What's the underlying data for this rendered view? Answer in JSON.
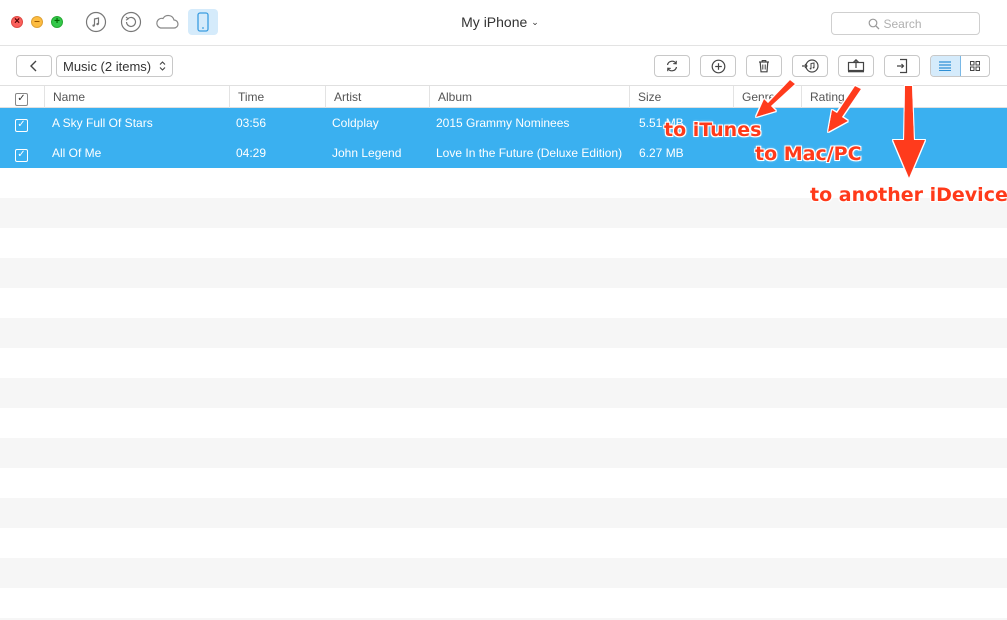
{
  "titlebar": {
    "device_name": "My iPhone",
    "search_placeholder": "Search",
    "modes": [
      "music-icon",
      "backup-icon",
      "cloud-icon",
      "iphone-icon"
    ]
  },
  "toolbar": {
    "back_icon": "chevron-left-icon",
    "folder_label": "Music (2 items)",
    "actions": [
      "refresh-icon",
      "add-icon",
      "delete-icon",
      "to-itunes-icon",
      "to-computer-icon",
      "to-device-icon"
    ],
    "view_modes": [
      "list-view-icon",
      "grid-view-icon"
    ]
  },
  "table": {
    "columns": [
      "Name",
      "Time",
      "Artist",
      "Album",
      "Size",
      "Genre",
      "Rating"
    ],
    "rows": [
      {
        "name": "A Sky Full Of Stars",
        "time": "03:56",
        "artist": "Coldplay",
        "album": "2015 Grammy Nominees",
        "size": "5.51 MB",
        "genre": "",
        "rating": ""
      },
      {
        "name": "All Of Me",
        "time": "04:29",
        "artist": "John Legend",
        "album": "Love In the Future (Deluxe Edition)",
        "size": "6.27 MB",
        "genre": "",
        "rating": ""
      }
    ]
  },
  "annotations": {
    "to_itunes": "to iTunes",
    "to_computer": "to Mac/PC",
    "to_device": "to another iDevice"
  },
  "colors": {
    "selection": "#3ab0f0",
    "stripe": "#f6f6f6",
    "annotation": "#ff3a1a",
    "active_button": "#d5ebfb"
  }
}
